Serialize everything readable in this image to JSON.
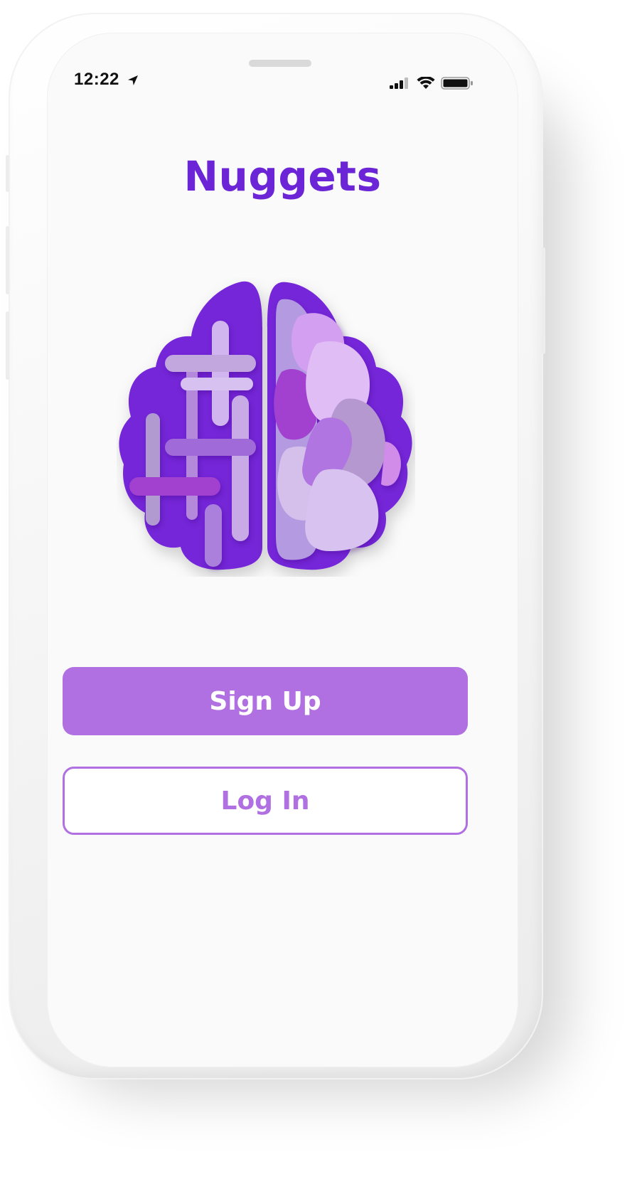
{
  "status_bar": {
    "time": "12:22",
    "icons": [
      "location-arrow-icon",
      "cellular-signal-icon",
      "wifi-icon",
      "battery-icon"
    ]
  },
  "app": {
    "title": "Nuggets",
    "logo": "brain-logo"
  },
  "actions": {
    "signup_label": "Sign Up",
    "login_label": "Log In"
  },
  "colors": {
    "brand_purple": "#6c25d6",
    "button_purple": "#b070e1",
    "screen_background": "#fafafa"
  }
}
